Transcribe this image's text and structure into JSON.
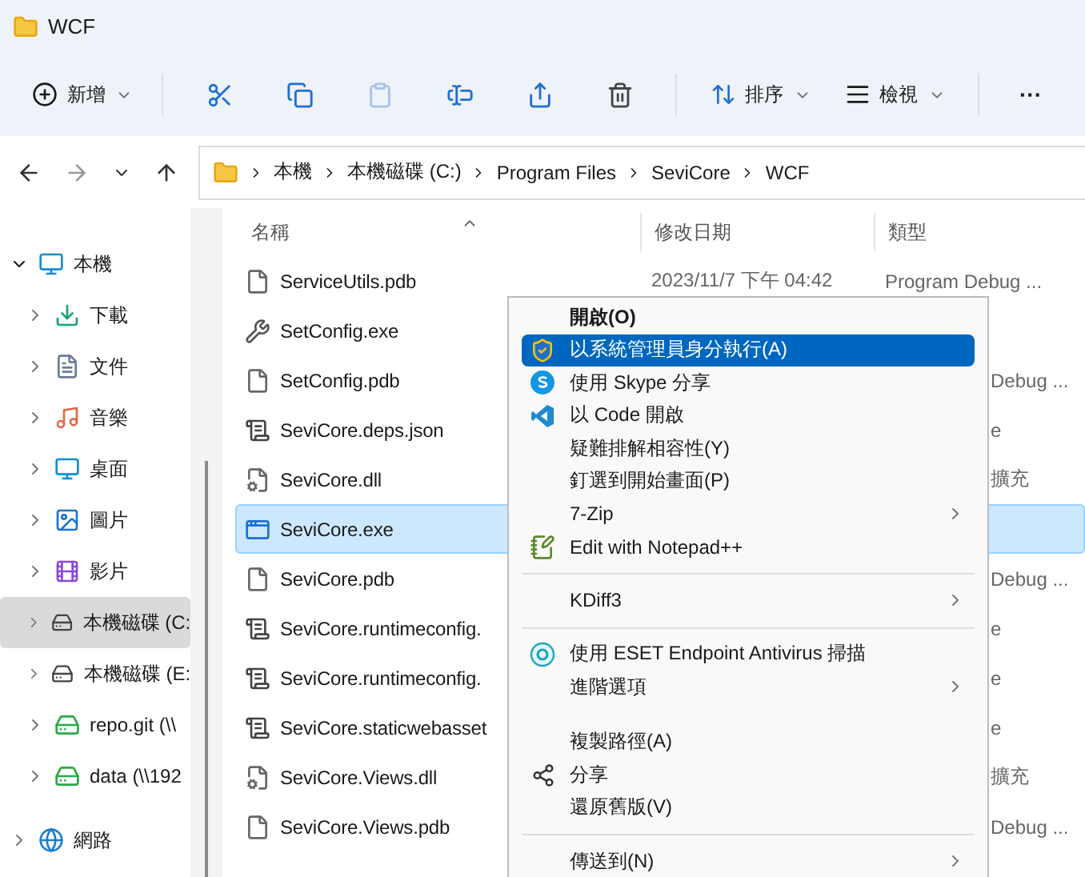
{
  "window": {
    "title": "WCF"
  },
  "toolbar": {
    "new_label": "新增",
    "sort_label": "排序",
    "view_label": "檢視",
    "more": "···"
  },
  "breadcrumb": [
    "本機",
    "本機磁碟 (C:)",
    "Program Files",
    "SeviCore",
    "WCF"
  ],
  "sidebar": {
    "items": [
      {
        "label": "本機",
        "expanded": true,
        "selected": false,
        "children": [
          {
            "label": "下載",
            "expanded": false,
            "selected": false
          },
          {
            "label": "文件",
            "expanded": false,
            "selected": false
          },
          {
            "label": "音樂",
            "expanded": false,
            "selected": false
          },
          {
            "label": "桌面",
            "expanded": false,
            "selected": false
          },
          {
            "label": "圖片",
            "expanded": false,
            "selected": false
          },
          {
            "label": "影片",
            "expanded": false,
            "selected": false
          },
          {
            "label": "本機磁碟 (C:",
            "expanded": false,
            "selected": true
          },
          {
            "label": "本機磁碟 (E:",
            "expanded": false,
            "selected": false
          },
          {
            "label": "repo.git (\\\\",
            "expanded": false,
            "selected": false
          },
          {
            "label": "data (\\\\192",
            "expanded": false,
            "selected": false
          }
        ]
      },
      {
        "label": "網路",
        "expanded": false,
        "selected": false
      }
    ]
  },
  "table": {
    "columns": [
      "名稱",
      "修改日期",
      "類型"
    ],
    "rows": [
      {
        "name": "ServiceUtils.pdb",
        "selected": false,
        "date": "2023/11/7 下午 04:42",
        "type": "Program Debug ..."
      },
      {
        "name": "SetConfig.exe",
        "selected": false
      },
      {
        "name": "SetConfig.pdb",
        "selected": false,
        "type": "Debug ..."
      },
      {
        "name": "SeviCore.deps.json",
        "selected": false,
        "type": "e"
      },
      {
        "name": "SeviCore.dll",
        "selected": false,
        "type": "擴充"
      },
      {
        "name": "SeviCore.exe",
        "selected": true
      },
      {
        "name": "SeviCore.pdb",
        "selected": false,
        "type": "Debug ..."
      },
      {
        "name": "SeviCore.runtimeconfig.",
        "selected": false,
        "type": "e"
      },
      {
        "name": "SeviCore.runtimeconfig.",
        "selected": false,
        "type": "e"
      },
      {
        "name": "SeviCore.staticwebasset",
        "selected": false,
        "type": "e"
      },
      {
        "name": "SeviCore.Views.dll",
        "selected": false,
        "type": "擴充"
      },
      {
        "name": "SeviCore.Views.pdb",
        "selected": false,
        "type": "Debug ..."
      }
    ]
  },
  "context_menu": {
    "items": [
      {
        "kind": "item",
        "label": "開啟(O)",
        "bold": true,
        "selected": false
      },
      {
        "kind": "item",
        "label": "以系統管理員身分執行(A)",
        "selected": true
      },
      {
        "kind": "item",
        "label": "使用 Skype 分享",
        "selected": false
      },
      {
        "kind": "item",
        "label": "以 Code 開啟",
        "selected": false
      },
      {
        "kind": "item",
        "label": "疑難排解相容性(Y)",
        "selected": false
      },
      {
        "kind": "item",
        "label": "釘選到開始畫面(P)",
        "selected": false
      },
      {
        "kind": "item",
        "label": "7-Zip",
        "submenu": true,
        "selected": false
      },
      {
        "kind": "item",
        "label": "Edit with Notepad++",
        "selected": false
      },
      {
        "kind": "separator"
      },
      {
        "kind": "item",
        "label": "KDiff3",
        "submenu": true,
        "selected": false
      },
      {
        "kind": "separator"
      },
      {
        "kind": "item",
        "label": "使用 ESET Endpoint Antivirus 掃描",
        "selected": false
      },
      {
        "kind": "item",
        "label": "進階選項",
        "submenu": true,
        "selected": false
      },
      {
        "kind": "obscured"
      },
      {
        "kind": "item",
        "label": "複製路徑(A)",
        "selected": false
      },
      {
        "kind": "item",
        "label": "分享",
        "selected": false
      },
      {
        "kind": "item",
        "label": "還原舊版(V)",
        "selected": false
      },
      {
        "kind": "separator"
      },
      {
        "kind": "item",
        "label": "傳送到(N)",
        "submenu": true,
        "selected": false
      }
    ]
  }
}
